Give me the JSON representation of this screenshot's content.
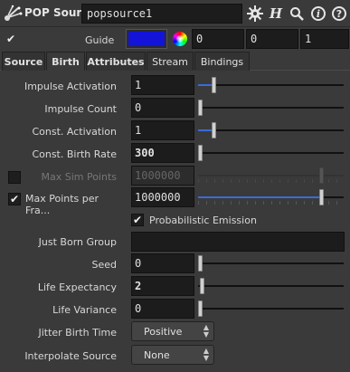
{
  "header": {
    "node_type": "POP Source",
    "node_name": "popsource1",
    "gear_icon": "gear-icon",
    "help_letter": "H",
    "info_icon": "i",
    "help_icon": "?"
  },
  "guide": {
    "label": "Guide",
    "color": "#1414d8",
    "values": [
      "0",
      "0",
      "1"
    ]
  },
  "tabs": [
    {
      "label": "Source"
    },
    {
      "label": "Birth"
    },
    {
      "label": "Attributes"
    },
    {
      "label": "Stream"
    },
    {
      "label": "Bindings"
    }
  ],
  "params": {
    "impulse_activation": {
      "label": "Impulse Activation",
      "value": "1"
    },
    "impulse_count": {
      "label": "Impulse Count",
      "value": "0"
    },
    "const_activation": {
      "label": "Const. Activation",
      "value": "1"
    },
    "const_birth_rate": {
      "label": "Const. Birth Rate",
      "value": "300"
    },
    "max_sim_points": {
      "label": "Max Sim Points",
      "value": "1000000"
    },
    "max_points_per_frame": {
      "label": "Max Points per Fra...",
      "value": "1000000"
    },
    "probabilistic_emission": {
      "label": "Probabilistic Emission"
    },
    "just_born_group": {
      "label": "Just Born Group",
      "value": ""
    },
    "seed": {
      "label": "Seed",
      "value": "0"
    },
    "life_expectancy": {
      "label": "Life Expectancy",
      "value": "2"
    },
    "life_variance": {
      "label": "Life Variance",
      "value": "0"
    },
    "jitter_birth_time": {
      "label": "Jitter Birth Time",
      "value": "Positive"
    },
    "interpolate_source": {
      "label": "Interpolate Source",
      "value": "None"
    }
  }
}
